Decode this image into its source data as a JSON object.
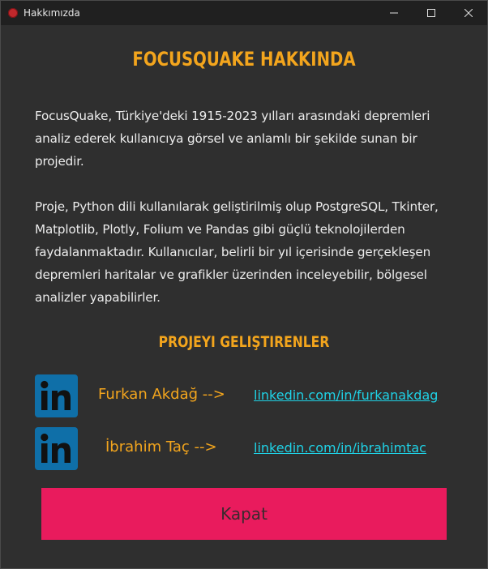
{
  "window": {
    "title": "Hakkımızda",
    "icon": "app-icon",
    "controls": [
      "minimize-icon",
      "maximize-icon",
      "close-icon"
    ]
  },
  "heading": "FOCUSQUAKE HAKKINDA",
  "paragraphs": [
    "FocusQuake, Türkiye'deki 1915-2023 yılları arasındaki depremleri analiz ederek kullanıcıya görsel ve anlamlı bir şekilde sunan bir projedir.",
    "Proje, Python dili kullanılarak geliştirilmiş olup PostgreSQL, Tkinter, Matplotlib, Plotly, Folium ve Pandas gibi güçlü teknolojilerden faydalanmaktadır. Kullanıcılar, belirli bir yıl içerisinde gerçekleşen depremleri haritalar ve grafikler üzerinden inceleyebilir, bölgesel analizler yapabilirler."
  ],
  "developers_heading": "PROJEYI GELIŞTIRENLER",
  "developers": [
    {
      "name": "Furkan Akdağ -->",
      "link": "linkedin.com/in/furkanakdag",
      "icon": "linkedin-icon"
    },
    {
      "name": "İbrahim Taç -->",
      "link": "linkedin.com/in/ibrahimtac",
      "icon": "linkedin-icon"
    }
  ],
  "close_button": "Kapat",
  "colors": {
    "background": "#2f2f2f",
    "titlebar": "#202020",
    "accent": "#f3a51d",
    "link": "#1fd2e6",
    "button": "#e91b5d",
    "linkedin": "#0f6fa8"
  }
}
